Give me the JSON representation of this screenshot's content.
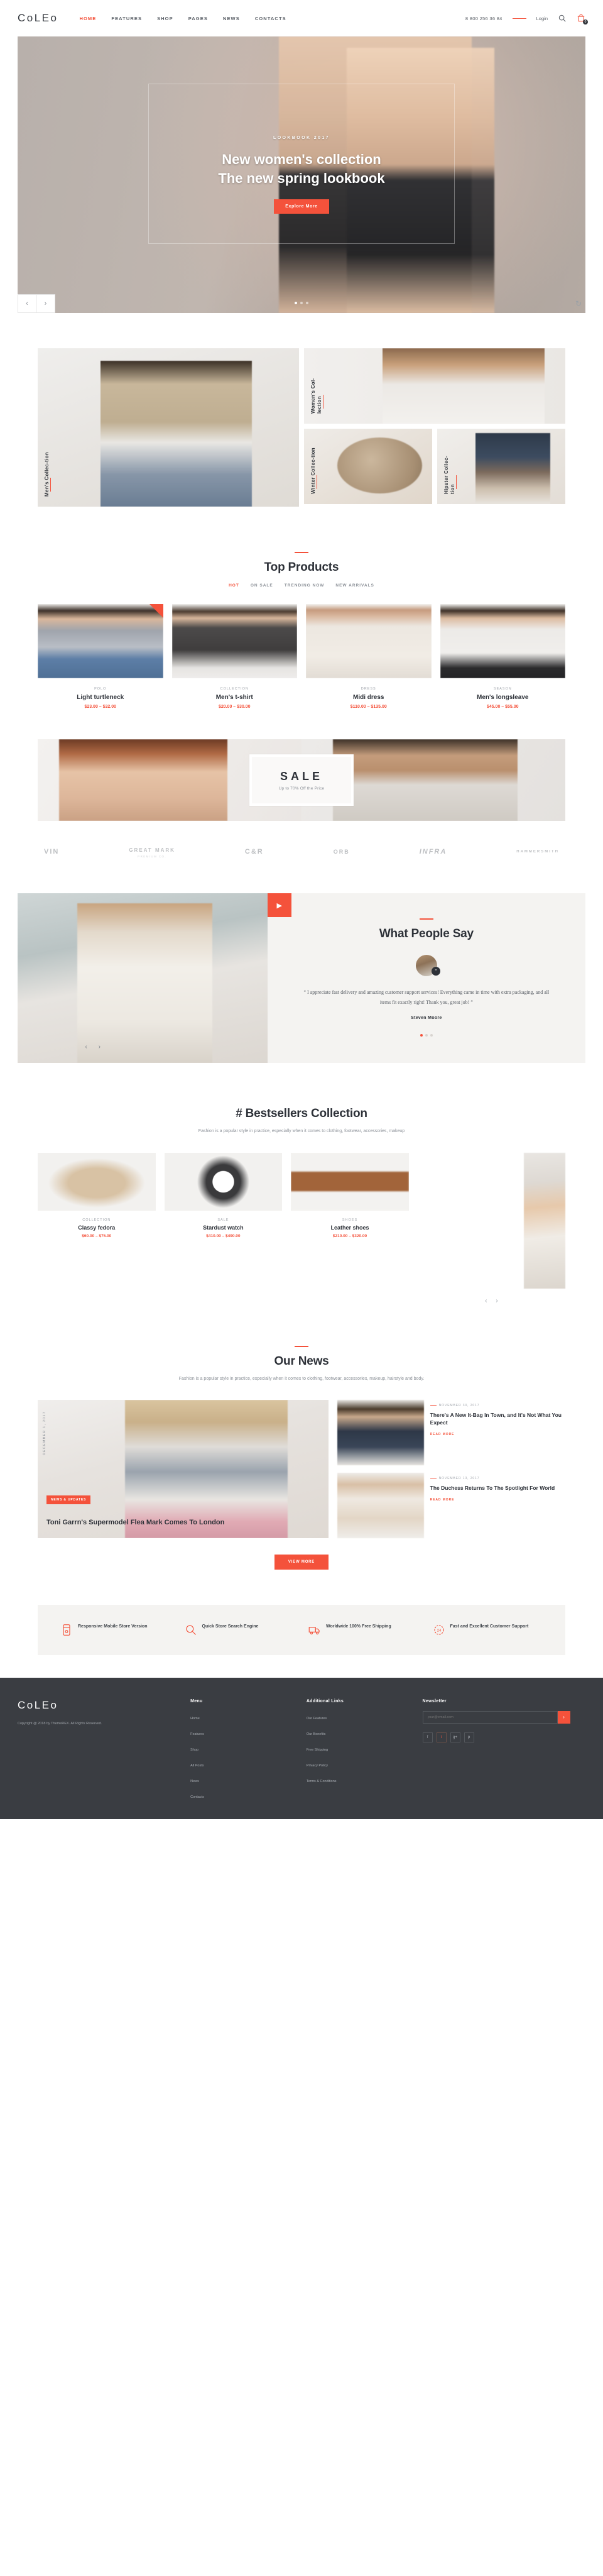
{
  "header": {
    "logo": "CoLEo",
    "nav": [
      {
        "label": "HOME",
        "active": true
      },
      {
        "label": "FEATURES",
        "active": false
      },
      {
        "label": "SHOP",
        "active": false
      },
      {
        "label": "PAGES",
        "active": false
      },
      {
        "label": "NEWS",
        "active": false
      },
      {
        "label": "CONTACTS",
        "active": false
      }
    ],
    "phone": "8 800 256 36 84",
    "login": "Login",
    "search_icon": "search-icon",
    "cart_icon": "cart-icon",
    "cart_count": "0"
  },
  "hero": {
    "kicker": "LOOKBOOK 2017",
    "title_line1": "New women's collection",
    "title_line2": "The new spring lookbook",
    "button": "Explore More",
    "prev_icon": "chevron-left-icon",
    "next_icon": "chevron-right-icon",
    "refresh_icon": "refresh-icon"
  },
  "categories": [
    {
      "label": "Men's Collec-tion"
    },
    {
      "label": "Women's Col-lection"
    },
    {
      "label": "Winter Collec-tion"
    },
    {
      "label": "Hipster Collec-tion"
    }
  ],
  "top_products": {
    "title": "Top Products",
    "tabs": [
      {
        "label": "HOT",
        "active": true
      },
      {
        "label": "ON SALE",
        "active": false
      },
      {
        "label": "TRENDING NOW",
        "active": false
      },
      {
        "label": "NEW ARRIVALS",
        "active": false
      }
    ],
    "items": [
      {
        "category": "POLO",
        "name": "Light turtleneck",
        "price": "$23.00 – $32.00",
        "sale": true
      },
      {
        "category": "COLLECTION",
        "name": "Men's t-shirt",
        "price": "$20.00 – $30.00",
        "sale": false
      },
      {
        "category": "DRESS",
        "name": "Midi dress",
        "price": "$110.00 – $135.00",
        "sale": false
      },
      {
        "category": "SEASON",
        "name": "Men's longsleave",
        "price": "$45.00 – $55.00",
        "sale": false
      }
    ]
  },
  "sale_banner": {
    "title": "SALE",
    "subtitle": "Up to 70% Off the Price"
  },
  "brands": [
    {
      "name": "VIN",
      "sub": ""
    },
    {
      "name": "GREAT MARK",
      "sub": "PREMIUM CO."
    },
    {
      "name": "C&R",
      "sub": ""
    },
    {
      "name": "ORB",
      "sub": ""
    },
    {
      "name": "INFRA",
      "sub": ""
    },
    {
      "name": "HAMMERSMITH",
      "sub": ""
    }
  ],
  "testimonial": {
    "title": "What People Say",
    "play_icon": "play-icon",
    "avatar": "avatar",
    "quote_icon": "quote-icon",
    "quote": "“ I appreciate fast delivery and amazing customer support services! Everything came in time with extra packaging, and all items fit exactly right! Thank you, great job! ”",
    "author": "Steven Moore",
    "prev_icon": "chevron-left-icon",
    "next_icon": "chevron-right-icon"
  },
  "bestsellers": {
    "title": "# Bestsellers Collection",
    "subtitle": "Fashion is a popular style in practice, especially when it comes to clothing, footwear, accessories, makeup",
    "items": [
      {
        "category": "COLLECTION",
        "name": "Classy fedora",
        "price": "$60.00 – $75.00"
      },
      {
        "category": "SALE",
        "name": "Stardust watch",
        "price": "$410.00 – $490.00"
      },
      {
        "category": "SHOES",
        "name": "Leather shoes",
        "price": "$210.00 – $320.00"
      }
    ],
    "prev_icon": "chevron-left-icon",
    "next_icon": "chevron-right-icon"
  },
  "news": {
    "title": "Our News",
    "subtitle": "Fashion is a popular style in practice, especially when it comes to clothing, footwear, accessories, makeup, hairstyle and body.",
    "featured": {
      "date": "DECEMBER 1, 2017",
      "tag": "NEWS & UPDATES",
      "title": "Toni Garrn's Supermodel Flea Mark Comes To London"
    },
    "cards": [
      {
        "date": "NOVEMBER 30, 2017",
        "title": "There's A New It-Bag In Town, and It's Not What You Expect",
        "more": "READ MORE"
      },
      {
        "date": "NOVEMBER 13, 2017",
        "title": "The Duchess Returns To The Spotlight For World",
        "more": "READ MORE"
      }
    ],
    "button": "View More"
  },
  "features": [
    {
      "icon": "mobile-store-icon",
      "text": "Responsive Mobile Store Version"
    },
    {
      "icon": "search-engine-icon",
      "text": "Quick Store Search Engine"
    },
    {
      "icon": "free-shipping-icon",
      "text": "Worldwide 100% Free Shipping"
    },
    {
      "icon": "support-24-icon",
      "text": "Fast and Excellent Customer Support"
    }
  ],
  "footer": {
    "logo": "CoLEo",
    "copyright": "Copyright @ 2018 by ThemeREX. All Rights Reserved.",
    "menu": {
      "title": "Menu",
      "items": [
        "Home",
        "Features",
        "Shop",
        "All Posts",
        "News",
        "Contacts"
      ]
    },
    "additional": {
      "title": "Additional Links",
      "items": [
        "Our Features",
        "Our Benefits",
        "Free Shipping",
        "Privacy Policy",
        "Terms & Conditions"
      ]
    },
    "newsletter": {
      "title": "Newsletter",
      "placeholder": "your@email.com",
      "submit_icon": "arrow-right-icon",
      "socials": [
        "facebook-icon",
        "twitter-icon",
        "google-plus-icon",
        "pinterest-icon"
      ]
    }
  },
  "colors": {
    "accent": "#f4523b",
    "dark": "#2d3138",
    "footer_bg": "#3a3d42",
    "muted": "#8b9097"
  }
}
